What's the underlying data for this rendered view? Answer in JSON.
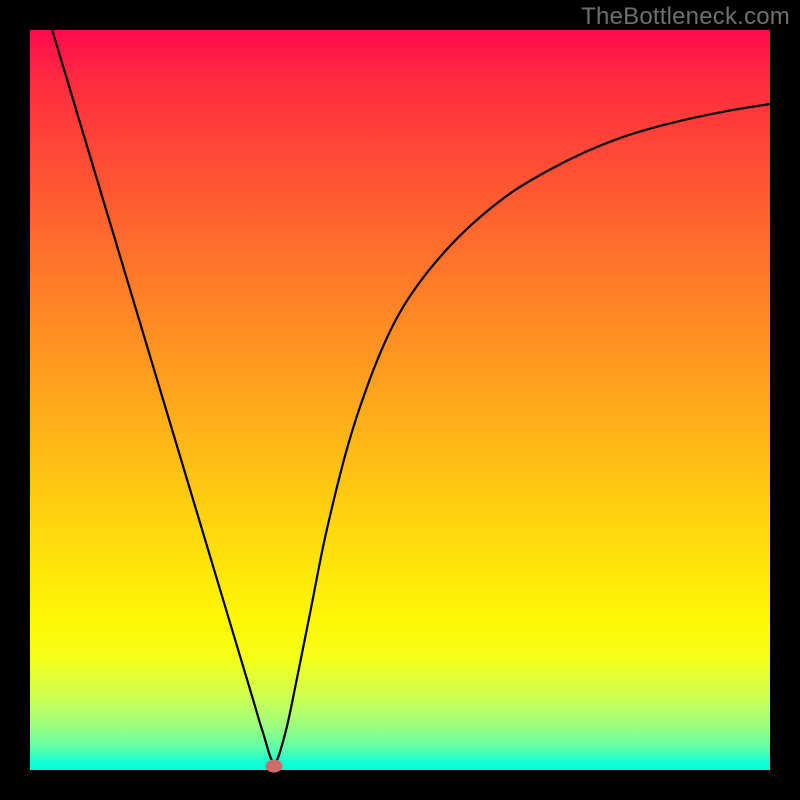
{
  "watermark": "TheBottleneck.com",
  "colors": {
    "background": "#000000",
    "gradient_top": "#ff0b4e",
    "gradient_bottom": "#00ffd5",
    "curve": "#000000",
    "marker": "#cc6d6b"
  },
  "chart_data": {
    "type": "line",
    "title": "",
    "xlabel": "",
    "ylabel": "",
    "xlim": [
      0,
      100
    ],
    "ylim": [
      0,
      100
    ],
    "grid": false,
    "legend": false,
    "series": [
      {
        "name": "bottleneck-curve",
        "x": [
          3,
          6,
          9,
          12,
          15,
          18,
          21,
          24,
          27,
          30,
          31.5,
          33,
          34.5,
          36,
          38,
          40,
          43,
          46,
          49,
          52,
          56,
          60,
          65,
          70,
          75,
          80,
          85,
          90,
          95,
          100
        ],
        "y": [
          100,
          90,
          80,
          70,
          60,
          50,
          40,
          30,
          20,
          10,
          5,
          1,
          5,
          12,
          22,
          32,
          44,
          53,
          60,
          65,
          70,
          74,
          78,
          81,
          83.5,
          85.5,
          87,
          88.2,
          89.2,
          90
        ]
      }
    ],
    "annotations": [
      {
        "name": "minimum-marker",
        "x": 33,
        "y": 0.5,
        "shape": "ellipse"
      }
    ]
  }
}
